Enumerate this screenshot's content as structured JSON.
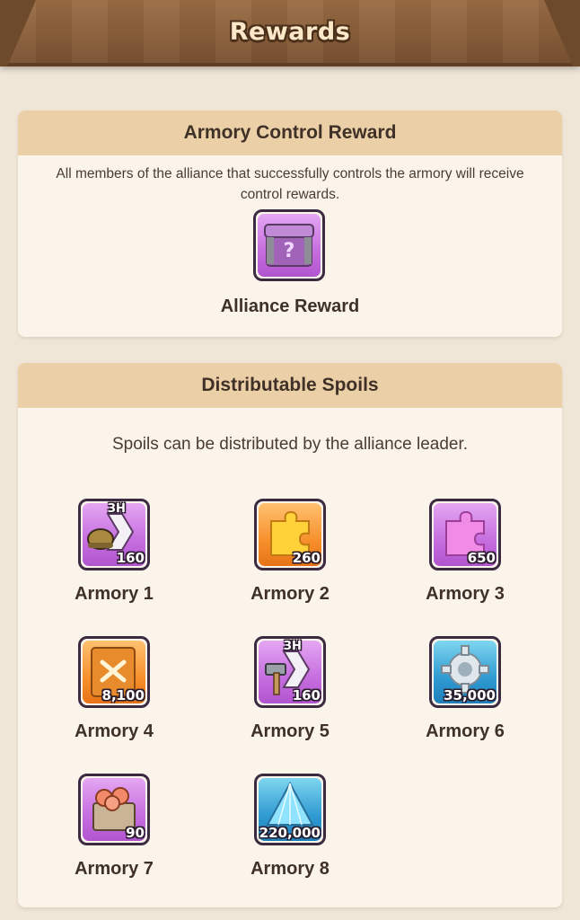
{
  "header": {
    "title": "Rewards"
  },
  "control_reward": {
    "title": "Armory Control Reward",
    "description": "All members of the alliance that successfully controls the armory will receive control rewards.",
    "reward": {
      "label": "Alliance Reward",
      "icon": "mystery-chest-icon",
      "color": "purple"
    }
  },
  "spoils": {
    "title": "Distributable Spoils",
    "description": "Spoils can be distributed by the alliance leader.",
    "items": [
      {
        "label": "Armory 1",
        "icon": "helmet-speedup-icon",
        "amount": "160",
        "badge": "3H",
        "color": "purple"
      },
      {
        "label": "Armory 2",
        "icon": "puzzle-piece-icon",
        "amount": "260",
        "badge": "",
        "color": "orange"
      },
      {
        "label": "Armory 3",
        "icon": "puzzle-piece-icon",
        "amount": "650",
        "badge": "",
        "color": "purple"
      },
      {
        "label": "Armory 4",
        "icon": "skill-book-icon",
        "amount": "8,100",
        "badge": "",
        "color": "orange"
      },
      {
        "label": "Armory 5",
        "icon": "hammer-speedup-icon",
        "amount": "160",
        "badge": "3H",
        "color": "purple"
      },
      {
        "label": "Armory 6",
        "icon": "gear-icon",
        "amount": "35,000",
        "badge": "",
        "color": "blue"
      },
      {
        "label": "Armory 7",
        "icon": "food-crate-icon",
        "amount": "90",
        "badge": "",
        "color": "purple"
      },
      {
        "label": "Armory 8",
        "icon": "crystal-icon",
        "amount": "220,000",
        "badge": "",
        "color": "blue"
      }
    ]
  }
}
